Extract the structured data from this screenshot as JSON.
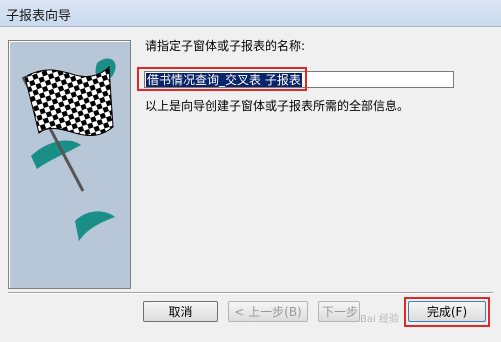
{
  "window": {
    "title": "子报表向导"
  },
  "prompt": "请指定子窗体或子报表的名称:",
  "name_field": {
    "value": "借书情况查询_交叉表 子报表"
  },
  "info": "以上是向导创建子窗体或子报表所需的全部信息。",
  "buttons": {
    "cancel": "取消",
    "back": "< 上一步(B)",
    "next": "下一步",
    "finish": "完成(F)"
  },
  "watermark": "Bai 经验",
  "icons": {
    "wizard_graphic": "checkered-flag-icon"
  },
  "colors": {
    "highlight": "#e02828",
    "selection": "#0a246a",
    "teal_accent": "#1a8f88"
  }
}
